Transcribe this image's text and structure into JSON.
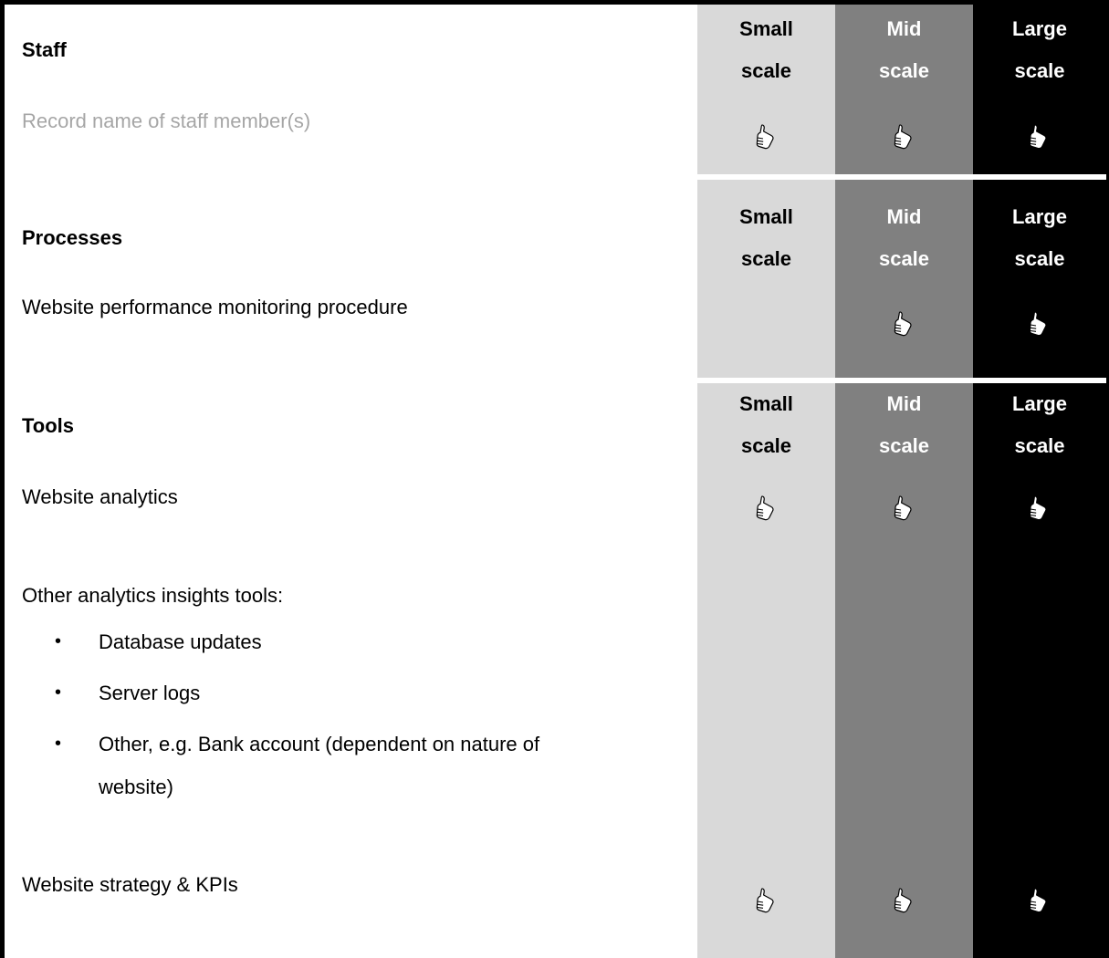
{
  "scale_headers": {
    "small_line1": "Small",
    "small_line2": "scale",
    "mid_line1": "Mid",
    "mid_line2": "scale",
    "large_line1": "Large",
    "large_line2": "scale"
  },
  "sections": {
    "staff": {
      "heading": "Staff",
      "item": "Record name of staff member(s)"
    },
    "processes": {
      "heading": "Processes",
      "item": "Website performance monitoring procedure"
    },
    "tools": {
      "heading": "Tools",
      "item1": "Website analytics",
      "item2": "Other analytics insights tools:",
      "bullets": [
        "Database updates",
        "Server logs",
        "Other, e.g. Bank account (dependent on nature of",
        "website)"
      ],
      "item3": "Website strategy & KPIs"
    }
  },
  "icons": {
    "thumb": "thumbs-up-icon"
  },
  "colors": {
    "small_scale": "#d9d9d9",
    "mid_scale": "#808080",
    "large_scale": "#000000",
    "muted_text": "#a6a6a6"
  }
}
